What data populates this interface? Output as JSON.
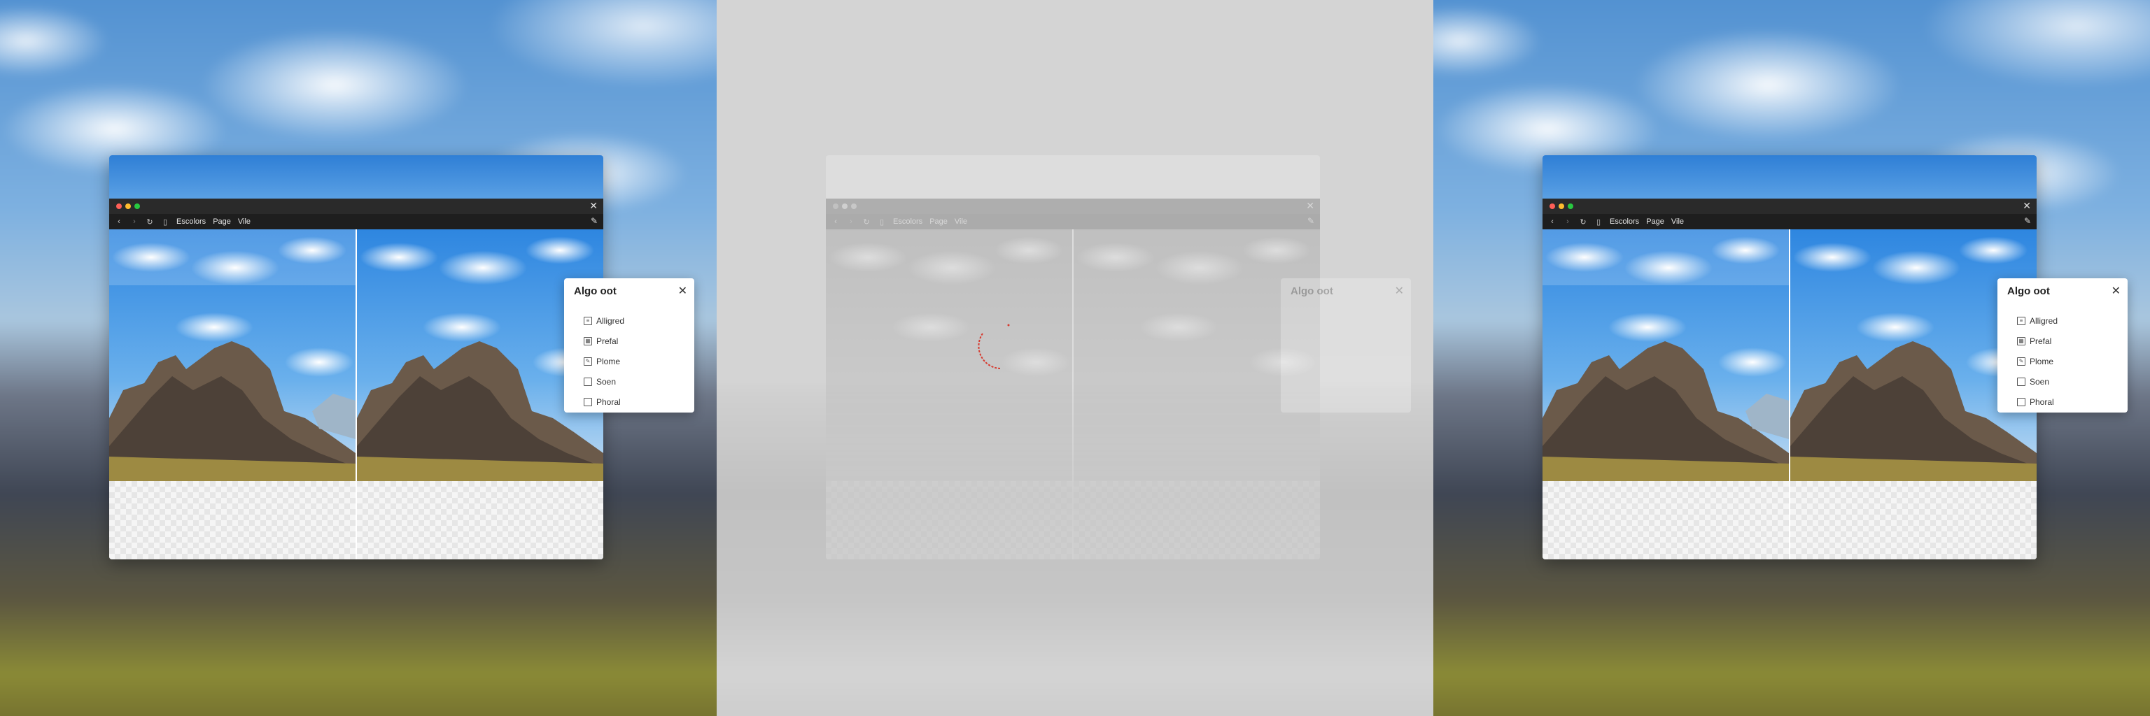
{
  "window": {
    "toolbar": {
      "links": [
        "Escolors",
        "Page",
        "Vile"
      ]
    }
  },
  "dialog": {
    "title": "Algo oot",
    "items": [
      {
        "label": "Alligred",
        "icon": "list-icon"
      },
      {
        "label": "Prefal",
        "icon": "grid-icon"
      },
      {
        "label": "Plome",
        "icon": "edit-icon"
      },
      {
        "label": "Soen",
        "icon": "checkbox-icon"
      },
      {
        "label": "Phoral",
        "icon": "checkbox-icon"
      }
    ]
  },
  "colors": {
    "titlebar": "#2a2a2a",
    "toolbar": "#1e1e1e",
    "close_dot": "#ff5f57",
    "minimize_dot": "#febc2e",
    "zoom_dot": "#28c840",
    "spinner": "#d63a2f"
  }
}
